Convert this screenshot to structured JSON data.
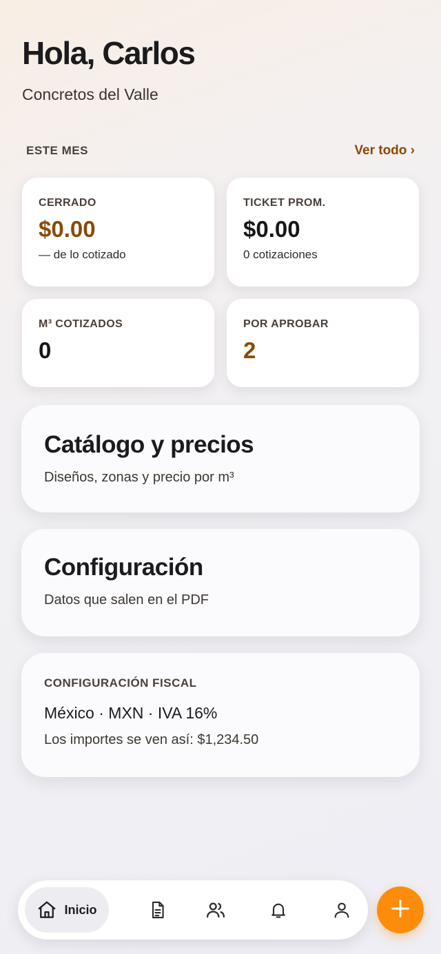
{
  "header": {
    "greeting": "Hola, Carlos",
    "company": "Concretos del Valle"
  },
  "month": {
    "title": "ESTE MES",
    "see_all": "Ver todo ›"
  },
  "stats": [
    {
      "label": "CERRADO",
      "value": "$0.00",
      "sub": "— de lo cotizado"
    },
    {
      "label": "TICKET PROM.",
      "value": "$0.00",
      "sub": "0 cotizaciones"
    },
    {
      "label": "M³ COTIZADOS",
      "value": "0"
    },
    {
      "label": "POR APROBAR",
      "value": "2"
    }
  ],
  "cards": {
    "catalog": {
      "title": "Catálogo y precios",
      "sub": "Diseños, zonas y precio por m³"
    },
    "config": {
      "title": "Configuración",
      "sub": "Datos que salen en el PDF"
    },
    "fiscal": {
      "label": "CONFIGURACIÓN FISCAL",
      "line1": "México · MXN · IVA 16%",
      "line2": "Los importes se ven así: $1,234.50"
    }
  },
  "tabbar": {
    "home_label": "Inicio",
    "icons": [
      "home-icon",
      "document-icon",
      "users-icon",
      "bell-icon",
      "user-icon",
      "plus-icon"
    ]
  },
  "colors": {
    "accent_text": "#8a4a08",
    "fab": "#fe8c0b"
  }
}
